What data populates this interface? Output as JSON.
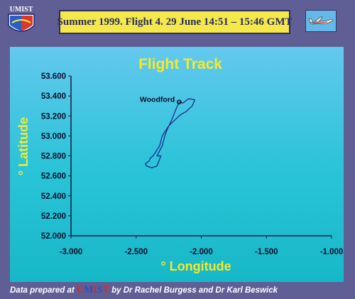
{
  "header": {
    "logo_text": "UMIST",
    "flight_info": "Summer 1999.   Flight 4.   29 June  14:51 – 15:46 GMT",
    "plane_icon": "aircraft-icon"
  },
  "chart_data": {
    "type": "line",
    "title": "Flight Track",
    "xlabel": "° Longitude",
    "ylabel": "° Latitude",
    "xlim": [
      -3.0,
      -1.0
    ],
    "ylim": [
      52.0,
      53.6
    ],
    "x_ticks": [
      -3.0,
      -2.5,
      -2.0,
      -1.5,
      -1.0
    ],
    "x_tick_labels": [
      "-3.000",
      "-2.500",
      "-2.000",
      "-1.500",
      "-1.000"
    ],
    "y_ticks": [
      52.0,
      52.2,
      52.4,
      52.6,
      52.8,
      53.0,
      53.2,
      53.4,
      53.6
    ],
    "y_tick_labels": [
      "52.000",
      "52.200",
      "52.400",
      "52.600",
      "52.800",
      "53.000",
      "53.200",
      "53.400",
      "53.600"
    ],
    "grid": false,
    "series": [
      {
        "color": "#1f2a8f",
        "x": [
          -2.17,
          -2.14,
          -2.1,
          -2.08,
          -2.05,
          -2.07,
          -2.12,
          -2.15,
          -2.17,
          -2.25,
          -2.3,
          -2.32,
          -2.37,
          -2.39,
          -2.4,
          -2.43,
          -2.42,
          -2.38,
          -2.34,
          -2.31,
          -2.34,
          -2.3,
          -2.28,
          -2.26,
          -2.23,
          -2.2,
          -2.17
        ],
        "y": [
          53.34,
          53.33,
          53.37,
          53.37,
          53.36,
          53.3,
          53.24,
          53.22,
          53.2,
          53.1,
          53.0,
          52.9,
          52.8,
          52.78,
          52.75,
          52.72,
          52.7,
          52.68,
          52.7,
          52.8,
          52.8,
          52.9,
          53.0,
          53.07,
          53.15,
          53.25,
          53.34
        ]
      }
    ],
    "annotations": [
      {
        "label": "Woodford",
        "x": -2.17,
        "y": 53.34
      }
    ]
  },
  "footer": {
    "prefix": "Data prepared at ",
    "umist": [
      "U",
      "M",
      "I",
      "S",
      "T"
    ],
    "suffix": " by Dr Rachel Burgess and Dr Karl Beswick"
  }
}
